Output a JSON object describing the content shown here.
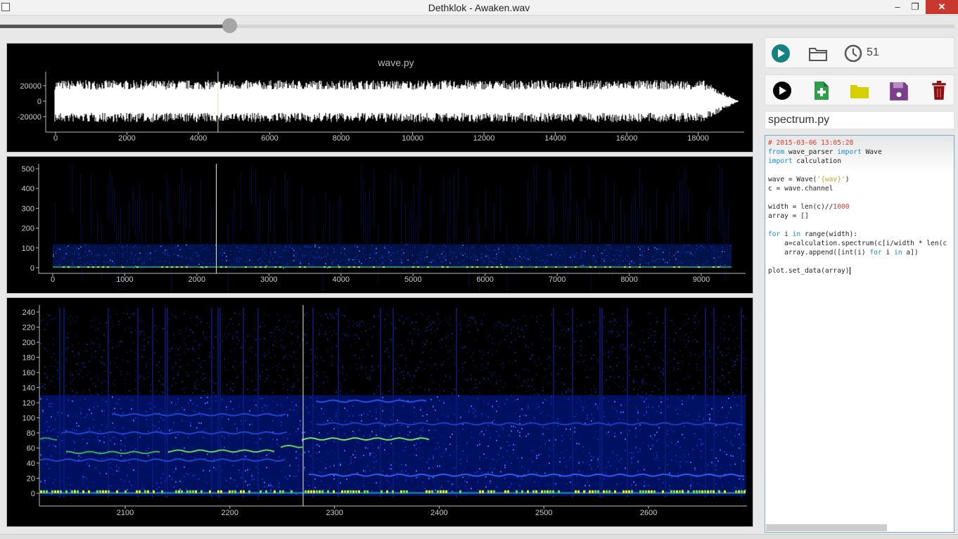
{
  "window": {
    "title": "Dethklok - Awaken.wav",
    "minimize": "–",
    "maximize": "❐",
    "close": "✕"
  },
  "playback": {
    "progress_fraction": 0.24
  },
  "plot_wave": {
    "title": "wave.py",
    "y_ticks": [
      "20000",
      "0",
      "-20000"
    ],
    "x_ticks": [
      "0",
      "2000",
      "4000",
      "6000",
      "8000",
      "10000",
      "12000",
      "14000",
      "16000",
      "18000"
    ],
    "cursor_x": 4550
  },
  "plot_spectrogram": {
    "y_ticks": [
      "500",
      "400",
      "300",
      "200",
      "100",
      "0"
    ],
    "x_ticks": [
      "0",
      "1000",
      "2000",
      "3000",
      "4000",
      "5000",
      "6000",
      "7000",
      "8000",
      "9000"
    ],
    "cursor_x": 2270
  },
  "plot_zoom": {
    "y_ticks": [
      "240",
      "220",
      "200",
      "180",
      "160",
      "140",
      "120",
      "100",
      "80",
      "60",
      "40",
      "20",
      "0"
    ],
    "x_ticks": [
      "2100",
      "2200",
      "2300",
      "2400",
      "2500",
      "2600"
    ],
    "cursor_x": 2270
  },
  "top_toolbar": {
    "counter": "51",
    "icons": [
      "play-icon",
      "folder-icon",
      "clock-icon"
    ]
  },
  "script_toolbar": {
    "icons": [
      "run-icon",
      "new-file-icon",
      "open-folder-icon",
      "save-icon",
      "delete-icon"
    ],
    "colors": {
      "new": "#2e9e4a",
      "open": "#d6cf00",
      "save": "#7b3f8e",
      "delete": "#8b1010"
    }
  },
  "editor": {
    "filename": "spectrum.py",
    "lines": [
      "# 2015-03-06 13:05:28",
      "from wave_parser import Wave",
      "import calculation",
      "",
      "wave = Wave('{wav}')",
      "c = wave.channel",
      "",
      "width = len(c)//1000",
      "array = []",
      "",
      "for i in range(width):",
      "    a=calculation.spectrum(c[i/width * len(c",
      "    array.append([int(i) for i in a])",
      "",
      "plot.set_data(array)"
    ]
  }
}
